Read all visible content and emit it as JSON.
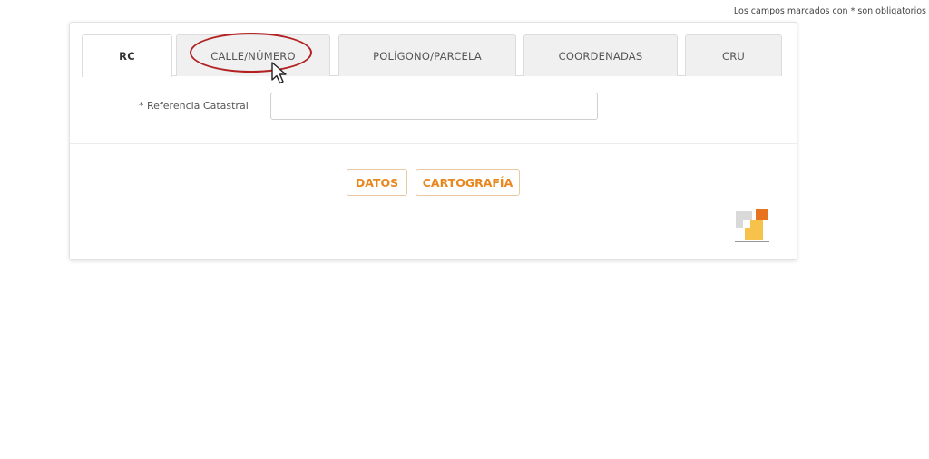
{
  "header": {
    "required_note": "Los campos marcados con * son obligatorios"
  },
  "tabs": [
    {
      "label": "RC",
      "active": true
    },
    {
      "label": "CALLE/NÚMERO",
      "active": false
    },
    {
      "label": "POLÍGONO/PARCELA",
      "active": false
    },
    {
      "label": "COORDENADAS",
      "active": false
    },
    {
      "label": "CRU",
      "active": false
    }
  ],
  "form": {
    "label": "* Referencia Catastral",
    "value": "",
    "placeholder": ""
  },
  "buttons": {
    "datos": "DATOS",
    "cartografia": "CARTOGRAFÍA"
  },
  "colors": {
    "accent": "#e8871e",
    "highlight": "#b22222"
  },
  "icons": {
    "logo": "catastro-logo-icon",
    "cursor": "mouse-pointer-icon"
  }
}
